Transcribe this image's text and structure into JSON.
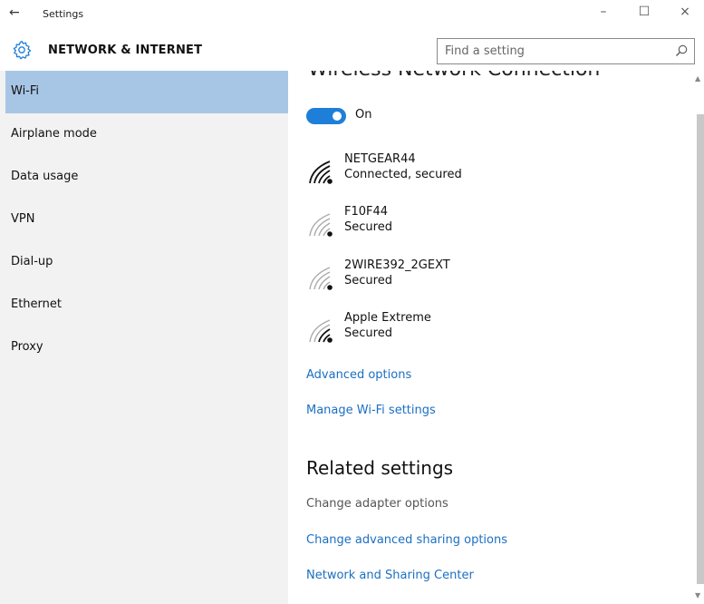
{
  "window": {
    "title": "Settings",
    "back_glyph": "←",
    "minimize_glyph": "–",
    "maximize_glyph": "☐",
    "close_glyph": "×"
  },
  "header": {
    "section_title": "NETWORK & INTERNET",
    "search_placeholder": "Find a setting"
  },
  "sidebar": {
    "items": [
      {
        "label": "Wi-Fi",
        "active": true
      },
      {
        "label": "Airplane mode"
      },
      {
        "label": "Data usage"
      },
      {
        "label": "VPN"
      },
      {
        "label": "Dial-up"
      },
      {
        "label": "Ethernet"
      },
      {
        "label": "Proxy"
      }
    ]
  },
  "main": {
    "heading": "Wireless Network Connection",
    "toggle_state": "On",
    "networks": [
      {
        "name": "NETGEAR44",
        "status": "Connected, secured",
        "signal": "full"
      },
      {
        "name": "F10F44",
        "status": "Secured",
        "signal": "low"
      },
      {
        "name": "2WIRE392_2GEXT",
        "status": "Secured",
        "signal": "low"
      },
      {
        "name": "Apple Extreme",
        "status": "Secured",
        "signal": "medium"
      }
    ],
    "advanced_options": "Advanced options",
    "manage_wifi": "Manage Wi-Fi settings",
    "related_heading": "Related settings",
    "change_adapter": "Change adapter options",
    "change_sharing": "Change advanced sharing options",
    "sharing_center": "Network and Sharing Center"
  },
  "colors": {
    "accent": "#1e7fd9",
    "link": "#1a6fc2",
    "selected_nav": "#a7c6e6",
    "sidebar_bg": "#f2f2f2"
  }
}
